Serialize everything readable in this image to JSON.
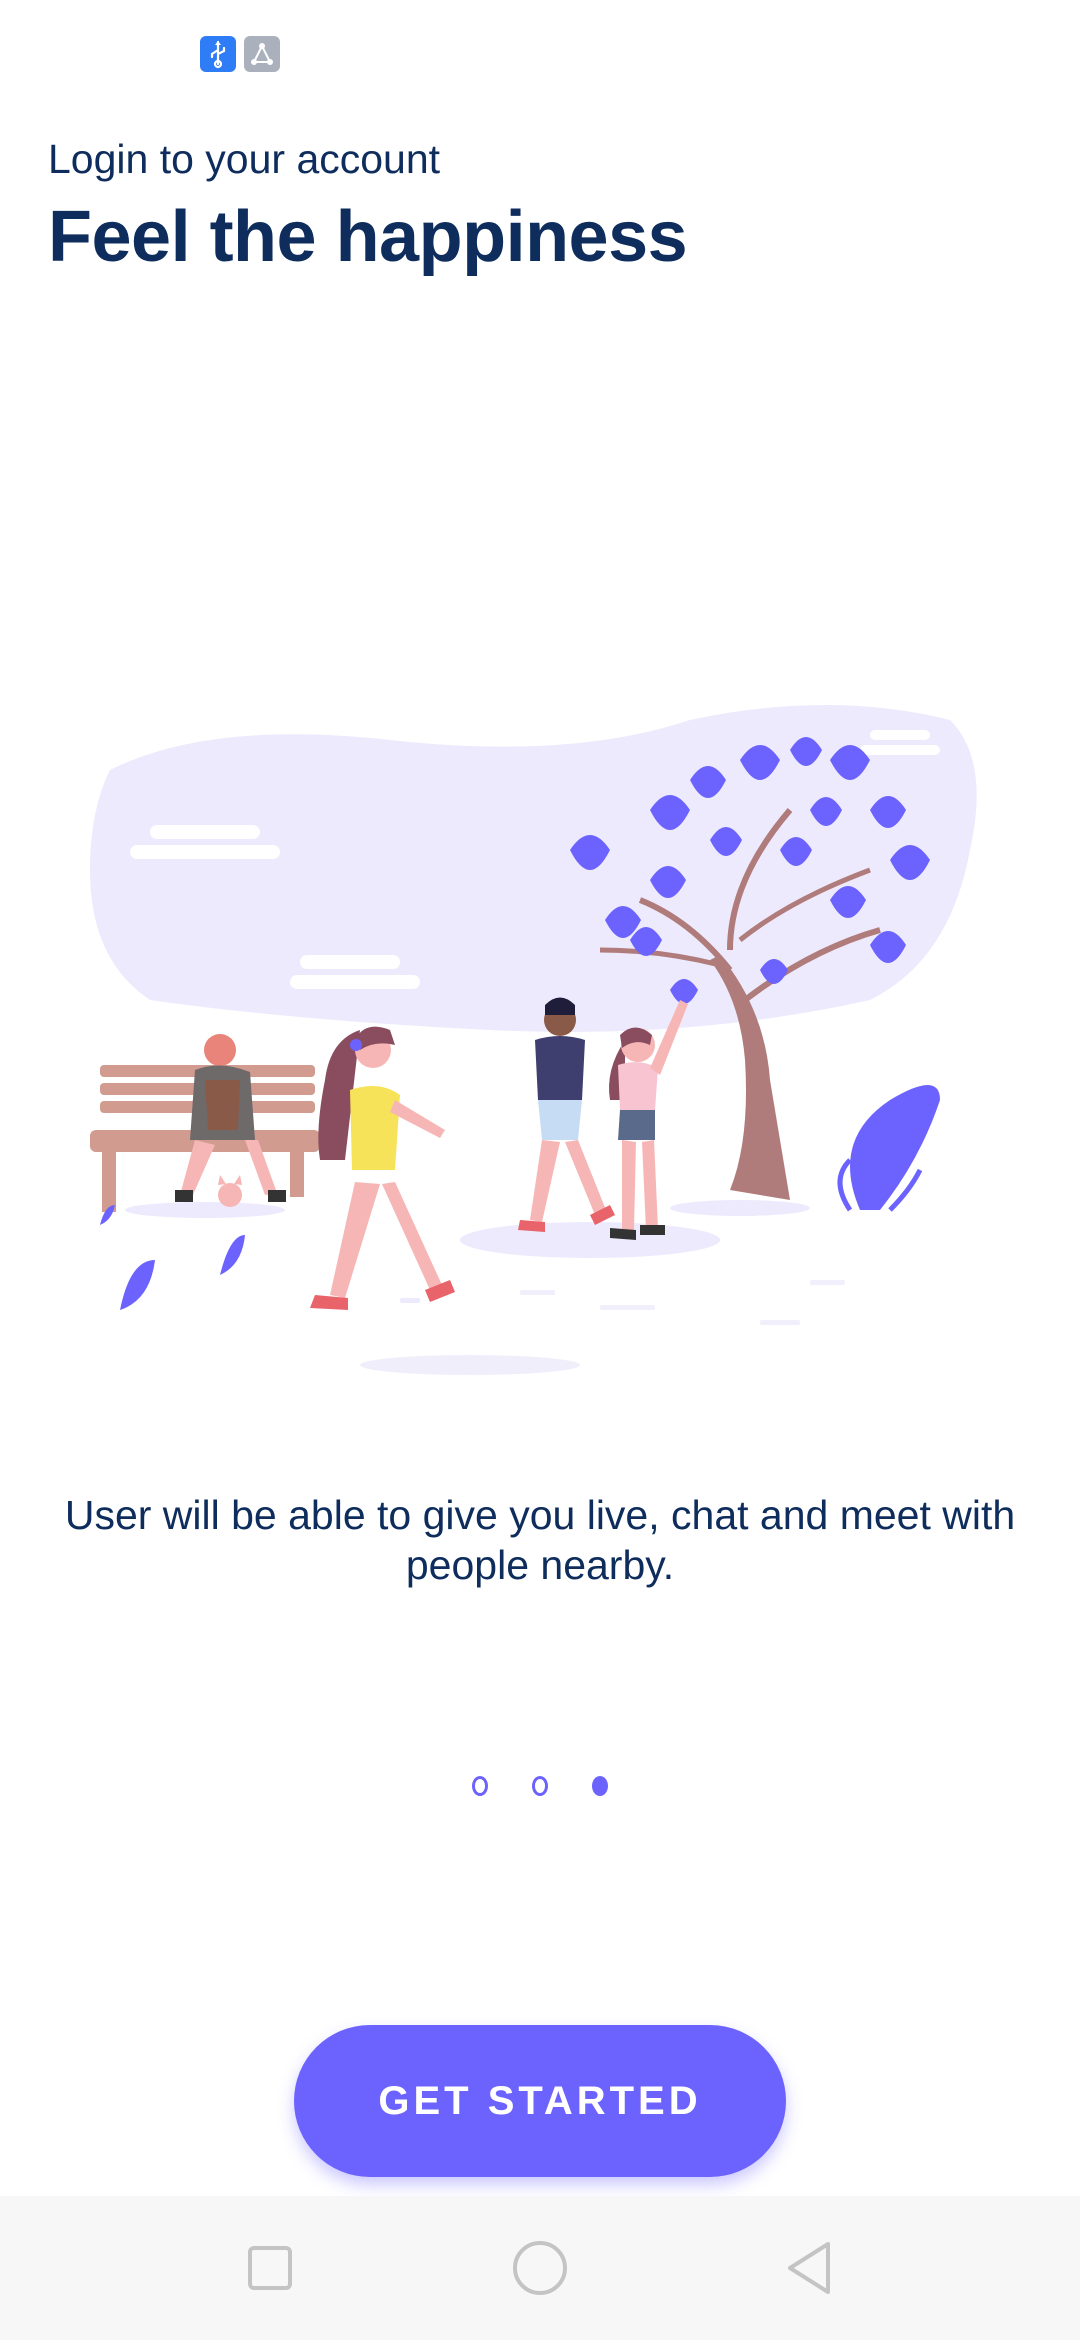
{
  "status_bar": {
    "icons": [
      "usb-icon",
      "share-icon"
    ],
    "colors": {
      "usb": "#2f7df6",
      "share": "#aab0bc"
    }
  },
  "header": {
    "subtitle": "Login to your account",
    "title": "Feel the happiness"
  },
  "illustration": {
    "icon": "park-people-illustration"
  },
  "description": "User will be able to give you live, chat and meet with people nearby.",
  "pager": {
    "count": 3,
    "active_index": 2
  },
  "cta": {
    "label": "GET STARTED"
  },
  "nav_bar": {
    "icons": [
      "recent-apps-icon",
      "home-icon",
      "back-icon"
    ]
  },
  "colors": {
    "accent": "#6c63ff",
    "text": "#0e2d5c",
    "nav_background": "#f7f7f7"
  }
}
